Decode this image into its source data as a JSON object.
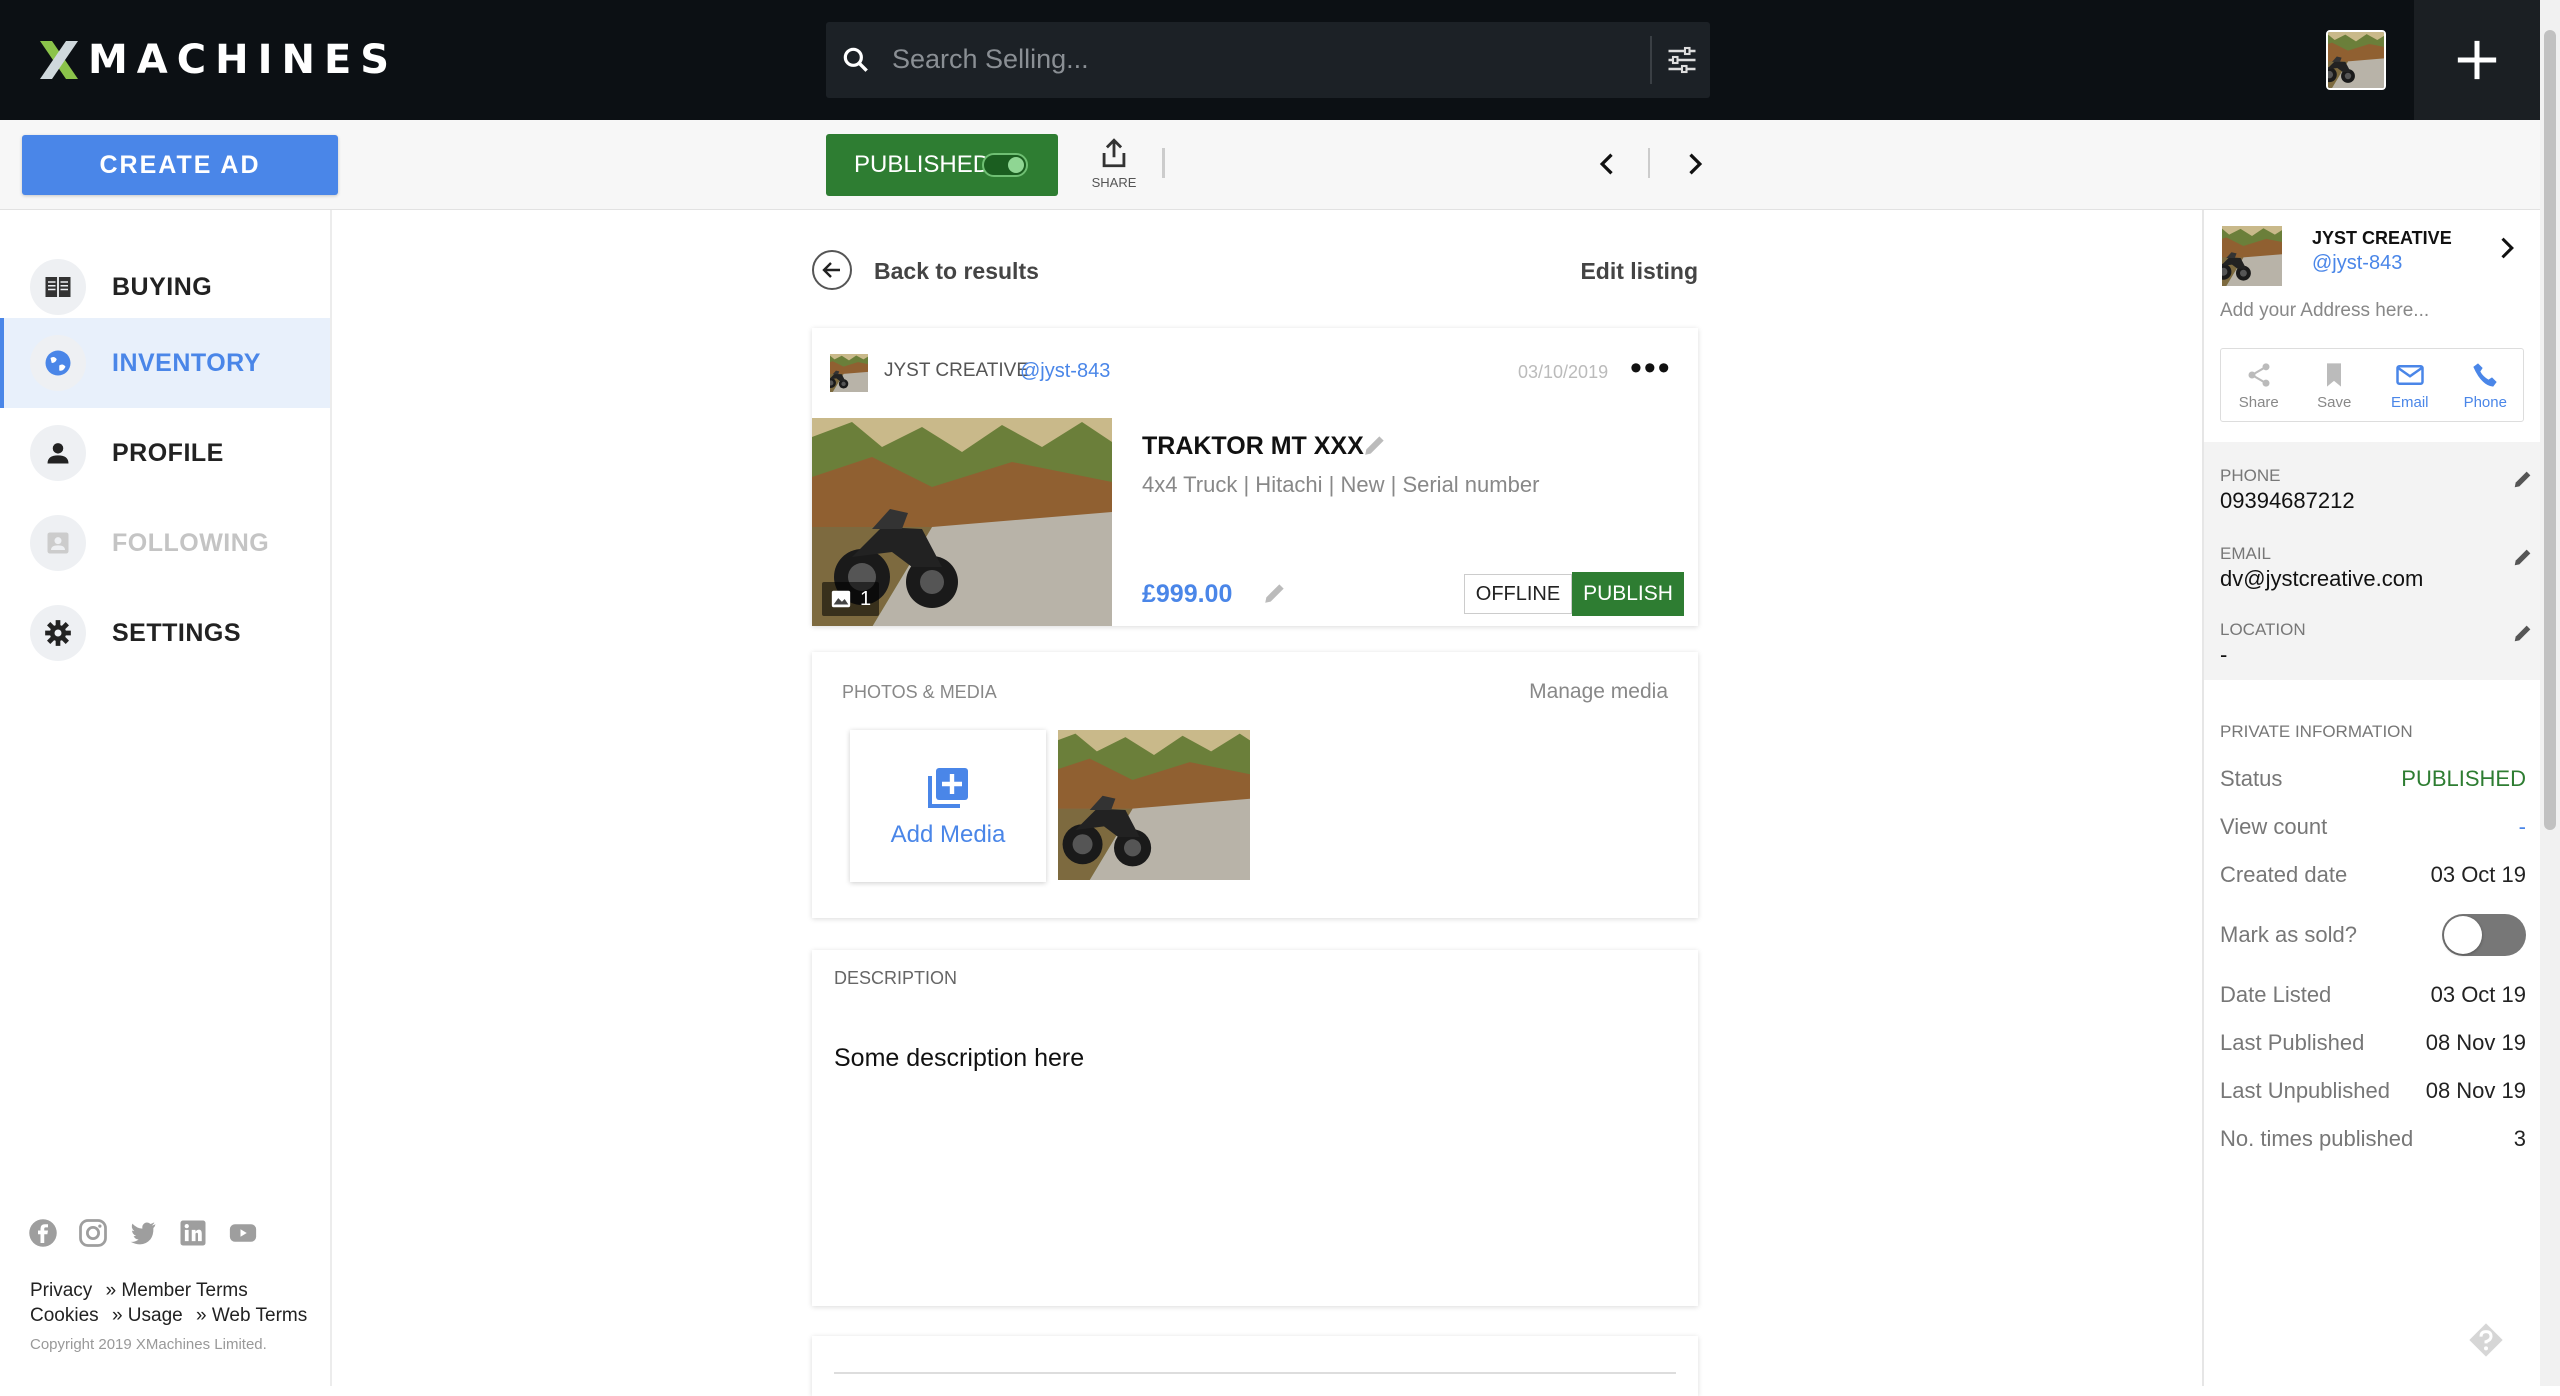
{
  "brand": {
    "logo_text": "MACHINES",
    "logo_mark": "X"
  },
  "search": {
    "placeholder": "Search Selling..."
  },
  "toolbar": {
    "create_ad_label": "CREATE AD",
    "published_label": "PUBLISHED",
    "share_label": "SHARE"
  },
  "sidebar": {
    "items": [
      {
        "label": "BUYING",
        "icon": "book-open-icon"
      },
      {
        "label": "INVENTORY",
        "icon": "globe-icon"
      },
      {
        "label": "PROFILE",
        "icon": "person-icon"
      },
      {
        "label": "FOLLOWING",
        "icon": "contact-card-icon"
      },
      {
        "label": "SETTINGS",
        "icon": "gear-icon"
      }
    ],
    "socials": [
      "facebook-icon",
      "instagram-icon",
      "twitter-icon",
      "linkedin-icon",
      "youtube-icon"
    ],
    "footer": {
      "privacy": "Privacy",
      "member_terms": "» Member Terms",
      "cookies": "Cookies",
      "usage": "» Usage",
      "web_terms": "» Web Terms",
      "copyright": "Copyright 2019 XMachines Limited."
    }
  },
  "main": {
    "back_label": "Back to results",
    "edit_listing_label": "Edit listing",
    "listing": {
      "seller_name": "JYST CREATIVE",
      "seller_handle": "@jyst-843",
      "date": "03/10/2019",
      "photo_count": "1",
      "title": "TRAKTOR MT XXX",
      "subtitle": "4x4 Truck | Hitachi | New | Serial number",
      "price": "£999.00",
      "offline_label": "OFFLINE",
      "publish_label": "PUBLISH"
    },
    "media": {
      "heading": "PHOTOS & MEDIA",
      "manage_label": "Manage media",
      "add_label": "Add Media"
    },
    "description": {
      "heading": "DESCRIPTION",
      "text": "Some description here"
    }
  },
  "right_panel": {
    "seller_name": "JYST CREATIVE",
    "seller_handle": "@jyst-843",
    "address_placeholder": "Add your Address here...",
    "actions": [
      {
        "label": "Share",
        "icon": "share-icon"
      },
      {
        "label": "Save",
        "icon": "bookmark-icon"
      },
      {
        "label": "Email",
        "icon": "mail-icon"
      },
      {
        "label": "Phone",
        "icon": "phone-icon"
      }
    ],
    "phone_label": "PHONE",
    "phone_value": "09394687212",
    "email_label": "EMAIL",
    "email_value": "dv@jystcreative.com",
    "location_label": "LOCATION",
    "location_value": "-",
    "private_heading": "PRIVATE INFORMATION",
    "rows": {
      "status_label": "Status",
      "status_value": "PUBLISHED",
      "views_label": "View count",
      "views_value": "-",
      "created_label": "Created date",
      "created_value": "03 Oct 19",
      "sold_label": "Mark as sold?",
      "listed_label": "Date Listed",
      "listed_value": "03 Oct 19",
      "last_pub_label": "Last Published",
      "last_pub_value": "08 Nov 19",
      "last_unpub_label": "Last Unpublished",
      "last_unpub_value": "08 Nov 19",
      "times_label": "No. times published",
      "times_value": "3"
    }
  },
  "colors": {
    "accent": "#4a86e8",
    "success": "#2e7d32",
    "topbar": "#0c1014",
    "logo_x": "#8bc34a"
  }
}
